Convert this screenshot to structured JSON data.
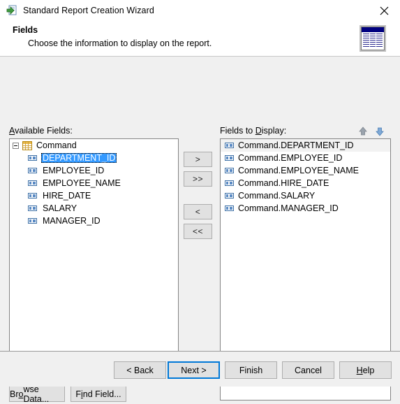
{
  "window": {
    "title": "Standard Report Creation Wizard",
    "icon": "report-wizard-icon",
    "close_label": "✕"
  },
  "header": {
    "title": "Fields",
    "subtitle": "Choose the information to display on the report.",
    "icon": "report-preview-icon"
  },
  "available_fields": {
    "label_prefix": "A",
    "label_rest": "vailable Fields:",
    "root": {
      "label": "Command",
      "icon": "table-icon",
      "expanded": true
    },
    "items": [
      {
        "label": "DEPARTMENT_ID",
        "selected": true
      },
      {
        "label": "EMPLOYEE_ID",
        "selected": false
      },
      {
        "label": "EMPLOYEE_NAME",
        "selected": false
      },
      {
        "label": "HIRE_DATE",
        "selected": false
      },
      {
        "label": "SALARY",
        "selected": false
      },
      {
        "label": "MANAGER_ID",
        "selected": false
      }
    ]
  },
  "fields_to_display": {
    "label_pre": "Fields to ",
    "label_key": "D",
    "label_post": "isplay:",
    "items": [
      {
        "label": "Command.DEPARTMENT_ID"
      },
      {
        "label": "Command.EMPLOYEE_ID"
      },
      {
        "label": "Command.EMPLOYEE_NAME"
      },
      {
        "label": "Command.HIRE_DATE"
      },
      {
        "label": "Command.SALARY"
      },
      {
        "label": "Command.MANAGER_ID"
      }
    ],
    "move_up_icon": "arrow-up-icon",
    "move_down_icon": "arrow-down-icon"
  },
  "transfer_buttons": {
    "move_right": ">",
    "move_all_right": ">>",
    "move_left": "<",
    "move_all_left": "<<"
  },
  "tool_buttons": {
    "browse_data_pre": "Br",
    "browse_data_key": "o",
    "browse_data_post": "wse Data...",
    "find_field_pre": "F",
    "find_field_key": "i",
    "find_field_post": "nd Field..."
  },
  "footer": {
    "back": "< Back",
    "next": "Next >",
    "finish": "Finish",
    "cancel": "Cancel",
    "help_key": "H",
    "help_rest": "elp"
  },
  "colors": {
    "accent": "#0078d7",
    "selection": "#3399ff",
    "window_bg": "#f0f0f0",
    "list_bg": "#ffffff",
    "button_bg": "#e1e1e1",
    "border": "#848484"
  }
}
